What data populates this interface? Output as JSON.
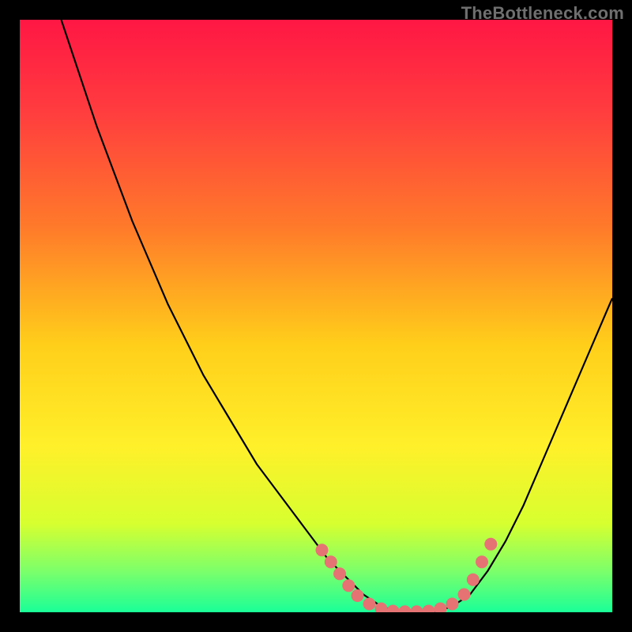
{
  "watermark": "TheBottleneck.com",
  "colors": {
    "background": "#000000",
    "curve": "#000000",
    "dot": "#e57373",
    "gradient_stops": [
      {
        "offset": 0.0,
        "color": "#ff1744"
      },
      {
        "offset": 0.15,
        "color": "#ff3b3f"
      },
      {
        "offset": 0.35,
        "color": "#ff7a2a"
      },
      {
        "offset": 0.55,
        "color": "#ffcf1a"
      },
      {
        "offset": 0.72,
        "color": "#fff02a"
      },
      {
        "offset": 0.85,
        "color": "#d7ff2f"
      },
      {
        "offset": 0.93,
        "color": "#7dff6a"
      },
      {
        "offset": 1.0,
        "color": "#1aff98"
      }
    ]
  },
  "chart_data": {
    "type": "line",
    "title": "",
    "xlabel": "",
    "ylabel": "",
    "xlim": [
      0,
      100
    ],
    "ylim": [
      0,
      100
    ],
    "x": [
      7,
      10,
      13,
      16,
      19,
      22,
      25,
      28,
      31,
      34,
      37,
      40,
      43,
      46,
      49,
      52,
      55,
      58,
      61,
      64,
      67,
      70,
      73,
      76,
      79,
      82,
      85,
      88,
      91,
      94,
      97,
      100
    ],
    "values": [
      100,
      91,
      82,
      74,
      66,
      59,
      52,
      46,
      40,
      35,
      30,
      25,
      21,
      17,
      13,
      9,
      6,
      3,
      1,
      0,
      0,
      0,
      1,
      3,
      7,
      12,
      18,
      25,
      32,
      39,
      46,
      53
    ],
    "highlight_points": [
      {
        "x": 51,
        "y": 10.5
      },
      {
        "x": 52.5,
        "y": 8.5
      },
      {
        "x": 54,
        "y": 6.5
      },
      {
        "x": 55.5,
        "y": 4.5
      },
      {
        "x": 57,
        "y": 2.8
      },
      {
        "x": 59,
        "y": 1.4
      },
      {
        "x": 61,
        "y": 0.6
      },
      {
        "x": 63,
        "y": 0.2
      },
      {
        "x": 65,
        "y": 0.1
      },
      {
        "x": 67,
        "y": 0.1
      },
      {
        "x": 69,
        "y": 0.2
      },
      {
        "x": 71,
        "y": 0.6
      },
      {
        "x": 73,
        "y": 1.4
      },
      {
        "x": 75,
        "y": 3.0
      },
      {
        "x": 76.5,
        "y": 5.5
      },
      {
        "x": 78,
        "y": 8.5
      },
      {
        "x": 79.5,
        "y": 11.5
      }
    ]
  }
}
